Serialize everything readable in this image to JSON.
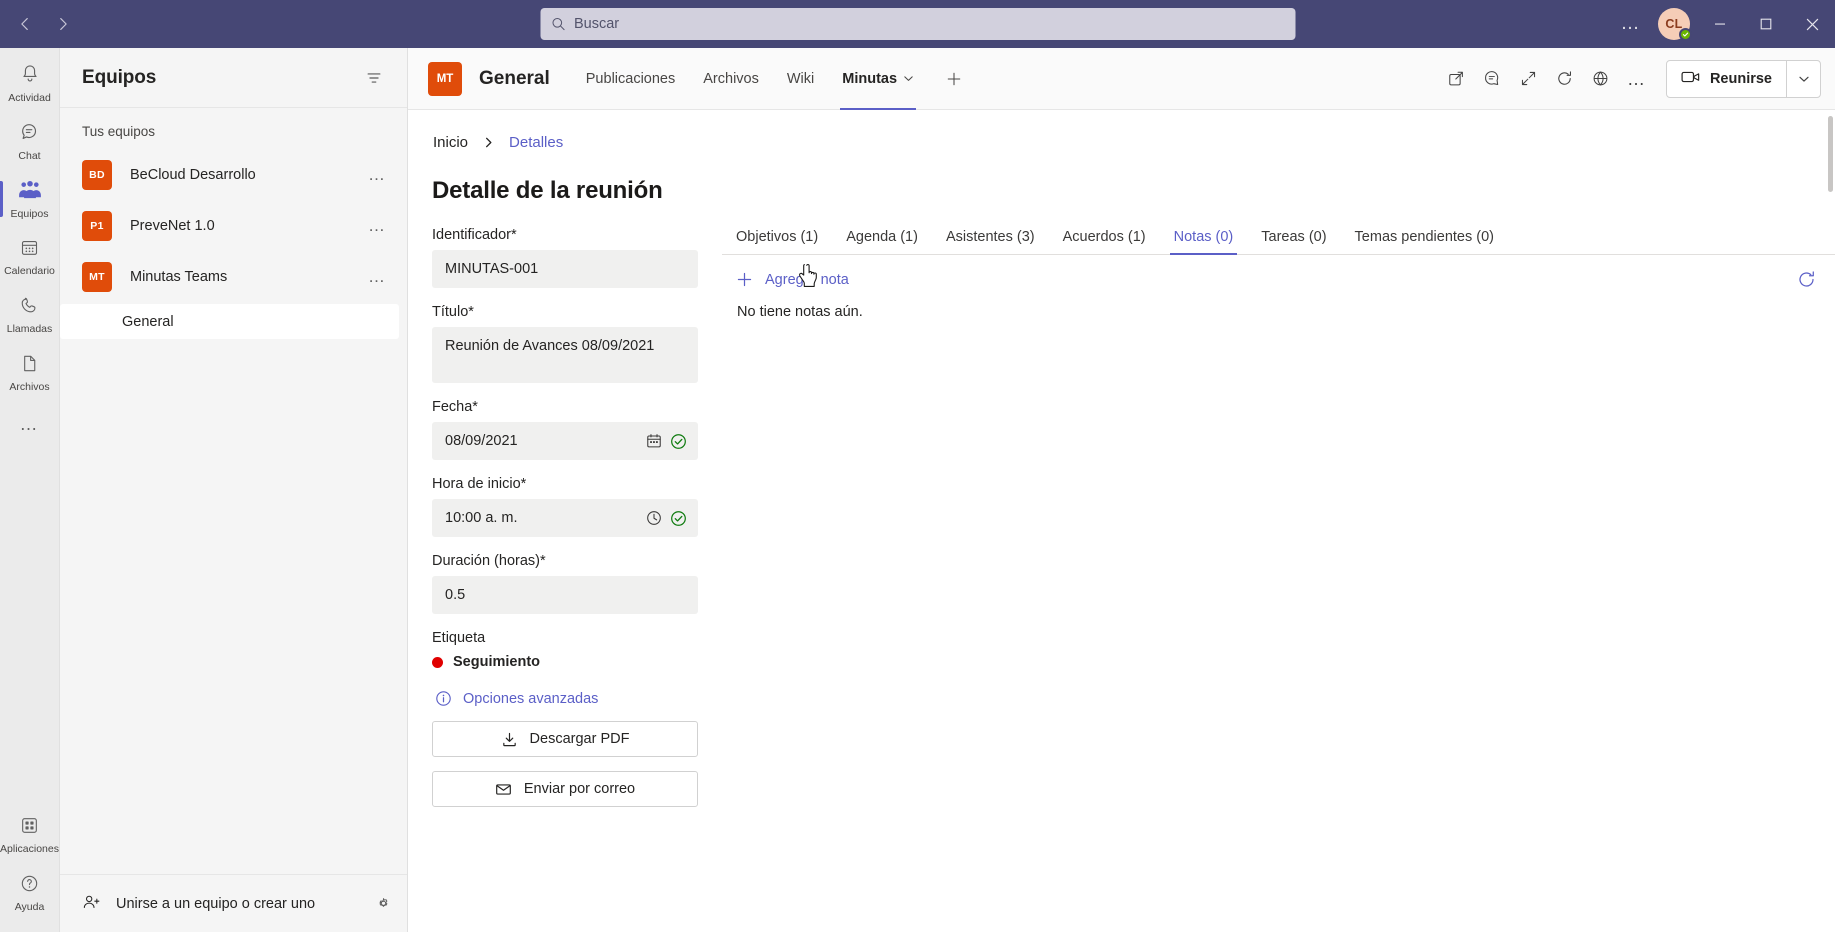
{
  "titlebar": {
    "back_label": "Atrás",
    "forward_label": "Adelante",
    "search_placeholder": "Buscar",
    "search_value": "",
    "more_label": "…",
    "avatar_initials": "CL",
    "presence": "Disponible",
    "minimize_label": "Minimizar",
    "maximize_label": "Maximizar",
    "close_label": "Cerrar"
  },
  "rail": {
    "items": [
      {
        "label": "Actividad",
        "icon": "bell-icon",
        "active": false
      },
      {
        "label": "Chat",
        "icon": "chat-icon",
        "active": false
      },
      {
        "label": "Equipos",
        "icon": "teams-icon",
        "active": true
      },
      {
        "label": "Calendario",
        "icon": "calendar-icon",
        "active": false
      },
      {
        "label": "Llamadas",
        "icon": "phone-icon",
        "active": false
      },
      {
        "label": "Archivos",
        "icon": "file-icon",
        "active": false
      }
    ],
    "more_label": "…",
    "bottom": [
      {
        "label": "Aplicaciones",
        "icon": "apps-icon"
      },
      {
        "label": "Ayuda",
        "icon": "help-icon"
      }
    ]
  },
  "teams_pane": {
    "title": "Equipos",
    "filter_label": "Filtrar",
    "section_label": "Tus equipos",
    "teams": [
      {
        "initials": "BD",
        "name": "BeCloud Desarrollo",
        "more": "…"
      },
      {
        "initials": "P1",
        "name": "PreveNet 1.0",
        "more": "…"
      },
      {
        "initials": "MT",
        "name": "Minutas Teams",
        "more": "…"
      }
    ],
    "channels": [
      {
        "name": "General",
        "selected": true
      }
    ],
    "footer_label": "Unirse a un equipo o crear uno",
    "settings_label": "Administrar equipos"
  },
  "channel_header": {
    "badge": "MT",
    "title": "General",
    "tabs": [
      {
        "label": "Publicaciones",
        "active": false,
        "chevron": false
      },
      {
        "label": "Archivos",
        "active": false,
        "chevron": false
      },
      {
        "label": "Wiki",
        "active": false,
        "chevron": false
      },
      {
        "label": "Minutas",
        "active": true,
        "chevron": true
      }
    ],
    "add_tab_label": "+",
    "icons": [
      {
        "name": "open-in-new-window-icon",
        "label": "Abrir en ventana nueva"
      },
      {
        "name": "conversation-icon",
        "label": "Conversación"
      },
      {
        "name": "expand-icon",
        "label": "Expandir"
      },
      {
        "name": "refresh-icon",
        "label": "Actualizar"
      },
      {
        "name": "globe-icon",
        "label": "Abrir en navegador"
      },
      {
        "name": "more-icon",
        "label": "…"
      }
    ],
    "meet_label": "Reunirse",
    "meet_dropdown_label": "Opciones de reunión"
  },
  "breadcrumb": {
    "items": [
      {
        "label": "Inicio",
        "link": false
      },
      {
        "label": "Detalles",
        "link": true
      }
    ]
  },
  "page": {
    "title": "Detalle de la reunión"
  },
  "form": {
    "fields": [
      {
        "label": "Identificador*",
        "value": "MINUTAS-001",
        "tall": false,
        "icon": null,
        "check": false
      },
      {
        "label": "Título*",
        "value": "Reunión  de Avances 08/09/2021",
        "tall": true,
        "icon": null,
        "check": false
      },
      {
        "label": "Fecha*",
        "value": "08/09/2021",
        "tall": false,
        "icon": "calendar-picker-icon",
        "check": true
      },
      {
        "label": "Hora de inicio*",
        "value": "10:00 a. m.",
        "tall": false,
        "icon": "clock-icon",
        "check": true
      },
      {
        "label": "Duración (horas)*",
        "value": "0.5",
        "tall": false,
        "icon": null,
        "check": false
      }
    ],
    "tag_label": "Etiqueta",
    "tag_name": "Seguimiento",
    "tag_color": "#e00000",
    "advanced_label": "Opciones avanzadas",
    "buttons": [
      {
        "label": "Descargar PDF",
        "icon": "download-icon"
      },
      {
        "label": "Enviar por correo",
        "icon": "mail-icon"
      }
    ]
  },
  "detail_tabs": {
    "items": [
      {
        "label": "Objetivos (1)",
        "active": false
      },
      {
        "label": "Agenda (1)",
        "active": false
      },
      {
        "label": "Asistentes (3)",
        "active": false
      },
      {
        "label": "Acuerdos (1)",
        "active": false
      },
      {
        "label": "Notas (0)",
        "active": true
      },
      {
        "label": "Tareas (0)",
        "active": false
      },
      {
        "label": "Temas pendientes (0)",
        "active": false
      }
    ]
  },
  "notes": {
    "add_label": "Agregar nota",
    "refresh_label": "Actualizar",
    "empty_text": "No tiene notas aún."
  },
  "colors": {
    "brand_purple": "#5b5fc7",
    "titlebar": "#464775",
    "team_badge": "#e04c0a",
    "tag_red": "#e00000",
    "presence_green": "#6bb700"
  }
}
